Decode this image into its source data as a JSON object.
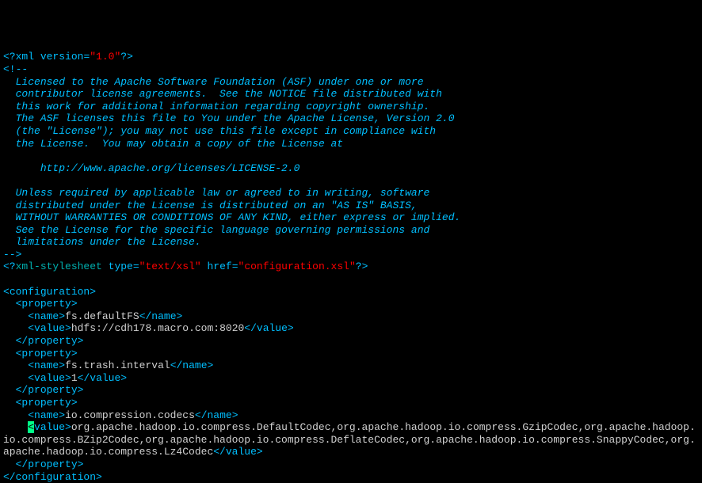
{
  "xml_decl": {
    "open": "<?",
    "pi_name": "xml",
    "space": " ",
    "attr": "version",
    "eq": "=",
    "val": "\"1.0\"",
    "close": "?>"
  },
  "comment_open": "<!--",
  "comment_body": "  Licensed to the Apache Software Foundation (ASF) under one or more\n  contributor license agreements.  See the NOTICE file distributed with\n  this work for additional information regarding copyright ownership.\n  The ASF licenses this file to You under the Apache License, Version 2.0\n  (the \"License\"); you may not use this file except in compliance with\n  the License.  You may obtain a copy of the License at\n\n      http://www.apache.org/licenses/LICENSE-2.0\n\n  Unless required by applicable law or agreed to in writing, software\n  distributed under the License is distributed on an \"AS IS\" BASIS,\n  WITHOUT WARRANTIES OR CONDITIONS OF ANY KIND, either express or implied.\n  See the License for the specific language governing permissions and\n  limitations under the License.",
  "comment_close": "-->",
  "stylesheet": {
    "open": "<?",
    "name": "xml-stylesheet",
    "space1": " ",
    "attr1": "type",
    "eq1": "=",
    "val1": "\"text/xsl\"",
    "space2": " ",
    "attr2": "href",
    "eq2": "=",
    "val2": "\"configuration.xsl\"",
    "close": "?>"
  },
  "tags": {
    "lt": "<",
    "lts": "</",
    "gt": ">",
    "configuration": "configuration",
    "property": "property",
    "name": "name",
    "value": "value"
  },
  "props": [
    {
      "name": "fs.defaultFS",
      "value": "hdfs://cdh178.macro.com:8020"
    },
    {
      "name": "fs.trash.interval",
      "value": "1"
    },
    {
      "name": "io.compression.codecs",
      "value_wrapped_prefix": "<",
      "value": "org.apache.hadoop.io.compress.DefaultCodec,org.apache.hadoop.io.compress.GzipCodec,org.apache.hadoop.io.compress.BZip2Codec,org.apache.hadoop.io.compress.DeflateCodec,org.apache.hadoop.io.compress.SnappyCodec,org.apache.hadoop.io.compress.Lz4Codec"
    }
  ],
  "indent": {
    "i1": "  ",
    "i2": "    "
  }
}
